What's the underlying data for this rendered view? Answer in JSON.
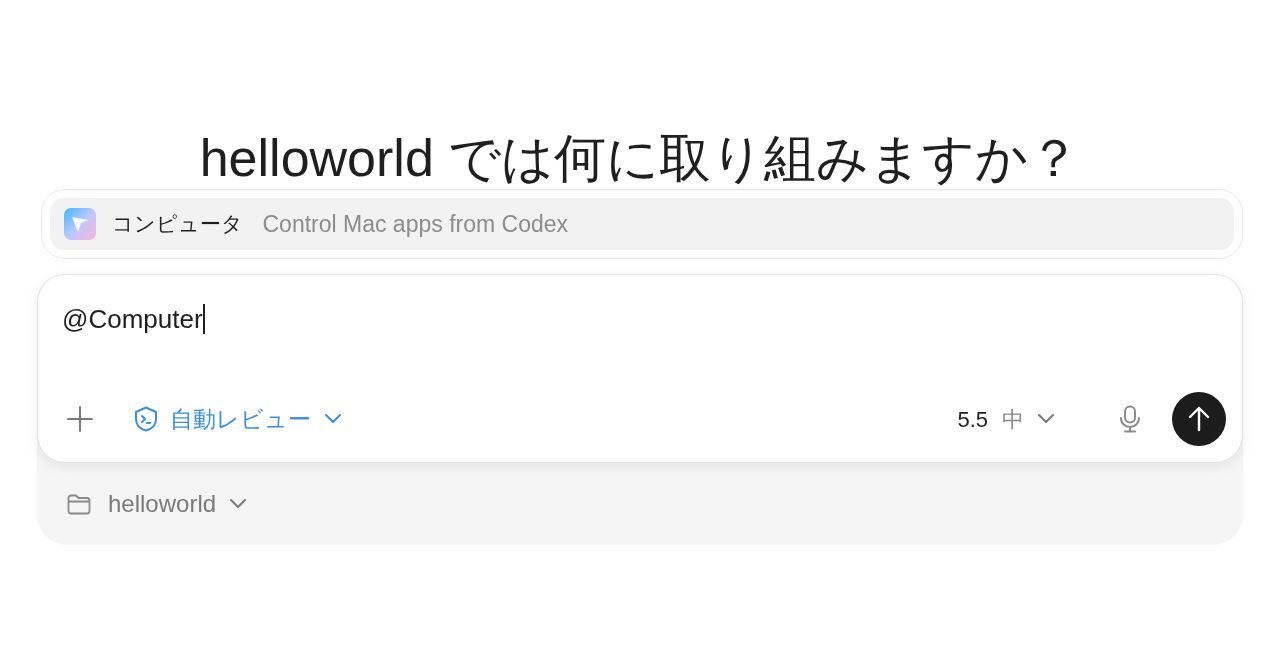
{
  "heading": "helloworld では何に取り組みますか？",
  "mention_menu": {
    "items": [
      {
        "title": "コンピュータ",
        "description": "Control Mac apps from Codex",
        "selected": true
      }
    ]
  },
  "composer": {
    "value": "@Computer",
    "approval": {
      "label": "自動レビュー"
    },
    "model": {
      "version": "5.5",
      "effort": "中"
    }
  },
  "project": {
    "label": "helloworld"
  }
}
